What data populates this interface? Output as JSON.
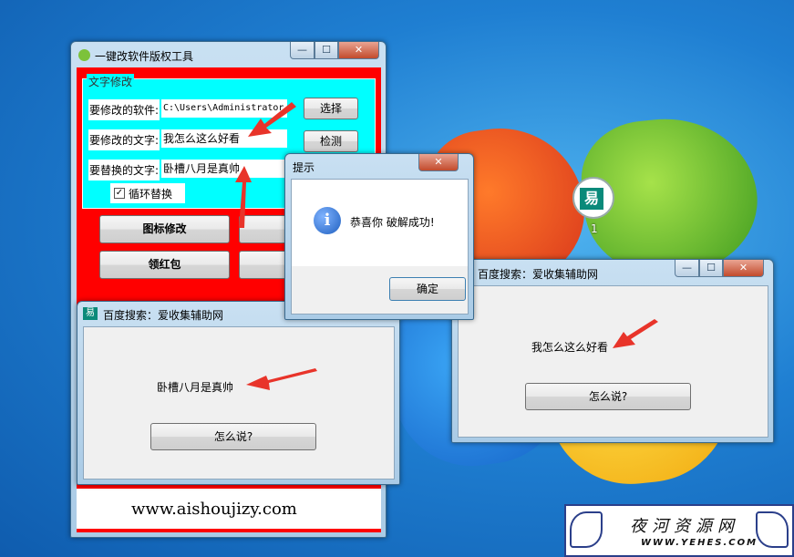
{
  "main_window": {
    "title": "一键改软件版权工具",
    "controls": {
      "minimize": "—",
      "maximize": "☐",
      "close": "✕"
    },
    "group_title": "文字修改",
    "software_label": "要修改的软件:",
    "software_value": "C:\\Users\\Administrator",
    "choose_button": "选择",
    "text_label": "要修改的文字:",
    "text_value": "我怎么这么好看",
    "detect_button": "检测",
    "replace_label": "要替换的文字:",
    "replace_value": "卧槽八月是真帅",
    "loop_checkbox": "循环替换",
    "icon_button": "图标修改",
    "redpacket_button": "领红包",
    "website": "www.aishoujizy.com"
  },
  "dialog": {
    "title": "提示",
    "message": "恭喜你 破解成功!",
    "ok_button": "确定"
  },
  "baidu_left": {
    "title": "百度搜索：爱收集辅助网",
    "label": "卧槽八月是真帅",
    "button": "怎么说?"
  },
  "baidu_right": {
    "title": "百度搜索：爱收集辅助网",
    "label": "我怎么这么好看",
    "button": "怎么说?"
  },
  "desktop_icon": {
    "label": "1"
  },
  "watermark": {
    "title": "夜河资源网",
    "url": "WWW.YEHES.COM"
  },
  "colors": {
    "red_panel": "#ff0000",
    "cyan_panel": "#00ffff",
    "arrow": "#e8342a",
    "info_icon": "#1f5fbf"
  }
}
